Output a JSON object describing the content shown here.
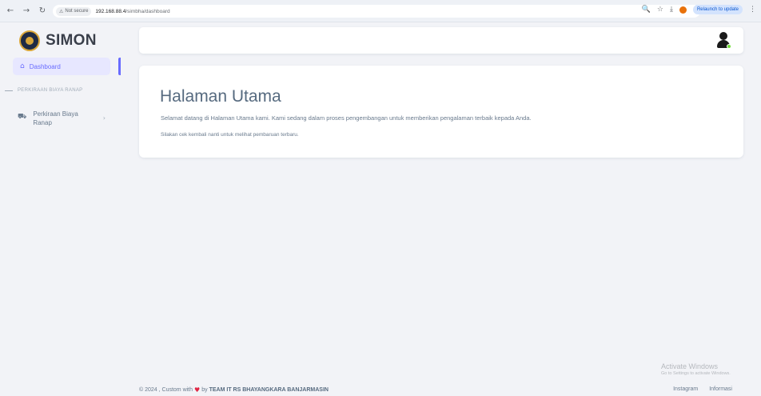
{
  "browser": {
    "security_label": "Not secure",
    "url_host": "192.168.88.4",
    "url_path": "/simbha/dashboard",
    "relaunch_label": "Relaunch to update"
  },
  "sidebar": {
    "brand": "SIMON",
    "active_item": {
      "label": "Dashboard",
      "icon": "home-icon"
    },
    "section_header": "PERKIRAAN BIAYA RANAP",
    "items": [
      {
        "label": "Perkiraan Biaya Ranap",
        "icon": "bed-icon"
      }
    ]
  },
  "main": {
    "title": "Halaman Utama",
    "text": "Selamat datang di Halaman Utama kami. Kami sedang dalam proses pengembangan untuk memberikan pengalaman terbaik kepada Anda.",
    "subtext": "Silakan cek kembali nanti untuk melihat pembaruan terbaru."
  },
  "footer": {
    "prefix": "© 2024 , Custom with",
    "by": "by",
    "team": "TEAM IT RS BHAYANGKARA BANJARMASIN",
    "links": [
      "Instagram",
      "Informasi"
    ]
  },
  "watermark": {
    "title": "Activate Windows",
    "subtitle": "Go to Settings to activate Windows."
  },
  "colors": {
    "accent": "#696cff",
    "active_bg": "#e7e7ff",
    "heart": "#e02443",
    "status_online": "#71dd37"
  }
}
